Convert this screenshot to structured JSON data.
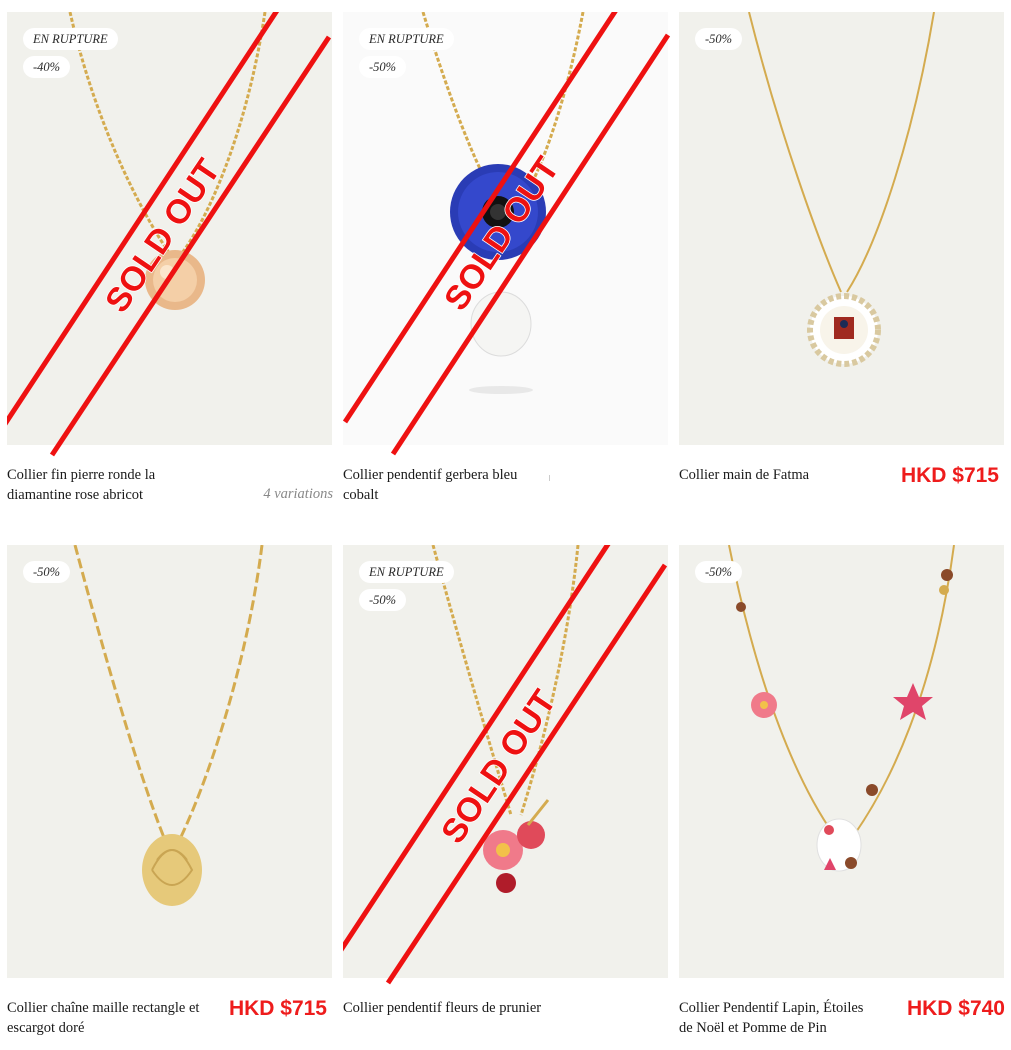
{
  "products": [
    {
      "name": "Collier fin pierre ronde la diamantine rose abricot",
      "badges": [
        "EN RUPTURE",
        "-40%"
      ],
      "variations": "4 variations",
      "price": "",
      "sold_out": true,
      "sold_out_label": "SOLD OUT"
    },
    {
      "name": "Collier pendentif gerbera bleu cobalt",
      "badges": [
        "EN RUPTURE",
        "-50%"
      ],
      "variations": "",
      "price": "",
      "sold_out": true,
      "sold_out_label": "SOLD OUT"
    },
    {
      "name": "Collier main de Fatma",
      "badges": [
        "-50%"
      ],
      "variations": "",
      "price": "HKD $715",
      "sold_out": false
    },
    {
      "name": "Collier chaîne maille rectangle et escargot doré",
      "badges": [
        "-50%"
      ],
      "variations": "",
      "price": "HKD $715",
      "sold_out": false
    },
    {
      "name": "Collier pendentif fleurs de prunier",
      "badges": [
        "EN RUPTURE",
        "-50%"
      ],
      "variations": "",
      "price": "",
      "sold_out": true,
      "sold_out_label": "SOLD OUT"
    },
    {
      "name": "Collier Pendentif Lapin, Étoiles de Noël et Pomme de Pin",
      "badges": [
        "-50%"
      ],
      "variations": "",
      "price": "HKD $740",
      "sold_out": false
    }
  ],
  "colors": {
    "accent_red": "#ee1c1c",
    "card_bg": "#f1f1ec",
    "gold": "#d4ab4f"
  }
}
